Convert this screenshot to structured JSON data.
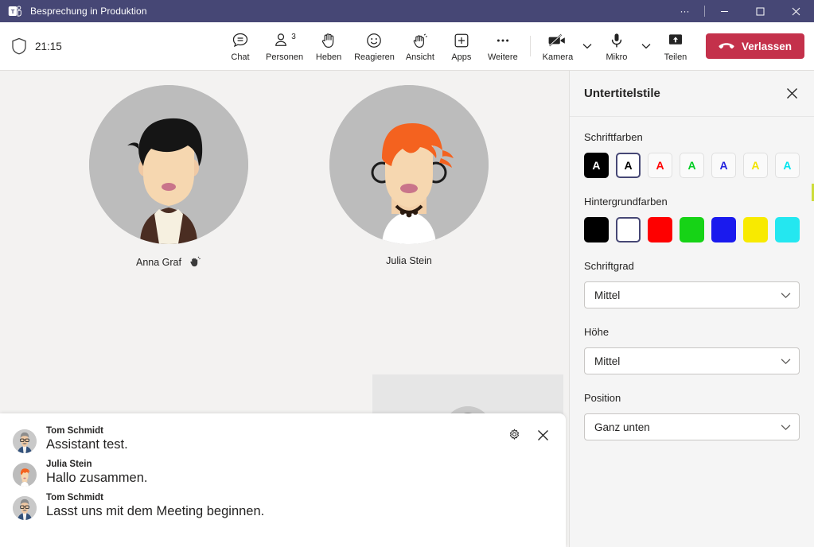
{
  "titlebar": {
    "app_icon": "teams-logo-icon",
    "title": "Besprechung in Produktion",
    "more_label": "···",
    "minimize_label": "—",
    "maximize_label": "□",
    "close_label": "✕"
  },
  "toolbar": {
    "shield_icon": "shield-icon",
    "timer": "21:15",
    "buttons": [
      {
        "icon": "chat-icon",
        "label": "Chat"
      },
      {
        "icon": "people-icon",
        "label": "Personen",
        "count": "3"
      },
      {
        "icon": "raise-hand-icon",
        "label": "Heben"
      },
      {
        "icon": "react-smiley-icon",
        "label": "Reagieren"
      },
      {
        "icon": "view-hand-icon",
        "label": "Ansicht"
      },
      {
        "icon": "apps-plus-icon",
        "label": "Apps"
      },
      {
        "icon": "more-dots-icon",
        "label": "Weitere"
      }
    ],
    "camera": {
      "icon": "camera-off-icon",
      "label": "Kamera",
      "chevron": "chevron-down-icon"
    },
    "mic": {
      "icon": "microphone-icon",
      "label": "Mikro",
      "chevron": "chevron-down-icon"
    },
    "share": {
      "icon": "share-screen-icon",
      "label": "Teilen"
    },
    "leave": {
      "icon": "hangup-phone-icon",
      "label": "Verlassen",
      "color": "#c4314b"
    }
  },
  "stage": {
    "participants": [
      {
        "name": "Anna Graf",
        "hand_raised": true,
        "hand_icon": "raised-hand-icon"
      },
      {
        "name": "Julia Stein",
        "hand_raised": false
      }
    ],
    "screen_share_tile": {
      "avatar": "tom-schmidt-avatar"
    }
  },
  "captions": {
    "settings_icon": "gear-icon",
    "close_icon": "close-icon",
    "entries": [
      {
        "speaker": "Tom Schmidt",
        "text": "Assistant test.",
        "avatar": "tom-schmidt-avatar"
      },
      {
        "speaker": "Julia Stein",
        "text": "Hallo zusammen.",
        "avatar": "julia-stein-avatar"
      },
      {
        "speaker": "Tom Schmidt",
        "text": "Lasst uns mit dem Meeting beginnen.",
        "avatar": "tom-schmidt-avatar"
      }
    ]
  },
  "panel": {
    "title": "Untertitelstile",
    "close_icon": "close-icon",
    "font_colors": {
      "label": "Schriftfarben",
      "swatches": [
        {
          "name": "black",
          "bg": "#000000",
          "letter": "A",
          "letter_color": "#ffffff",
          "selected": false,
          "filled": true
        },
        {
          "name": "white",
          "bg": "#ffffff",
          "letter": "A",
          "letter_color": "#000000",
          "selected": true,
          "filled": false
        },
        {
          "name": "red",
          "bg": "#fafafa",
          "letter": "A",
          "letter_color": "#ff0000",
          "selected": false,
          "filled": false
        },
        {
          "name": "green",
          "bg": "#fafafa",
          "letter": "A",
          "letter_color": "#00cc22",
          "selected": false,
          "filled": false
        },
        {
          "name": "blue",
          "bg": "#fafafa",
          "letter": "A",
          "letter_color": "#2222dd",
          "selected": false,
          "filled": false
        },
        {
          "name": "yellow",
          "bg": "#fafafa",
          "letter": "A",
          "letter_color": "#f2e300",
          "selected": false,
          "filled": false
        },
        {
          "name": "cyan",
          "bg": "#fafafa",
          "letter": "A",
          "letter_color": "#00e5ee",
          "selected": false,
          "filled": false
        }
      ]
    },
    "background_colors": {
      "label": "Hintergrundfarben",
      "swatches": [
        {
          "name": "black",
          "bg": "#000000",
          "selected": false
        },
        {
          "name": "white",
          "bg": "#ffffff",
          "selected": true
        },
        {
          "name": "red",
          "bg": "#fe0000",
          "selected": false
        },
        {
          "name": "green",
          "bg": "#16d316",
          "selected": false
        },
        {
          "name": "blue",
          "bg": "#1a1aee",
          "selected": false
        },
        {
          "name": "yellow",
          "bg": "#f8ea00",
          "selected": false
        },
        {
          "name": "cyan",
          "bg": "#24e7f0",
          "selected": false
        }
      ]
    },
    "font_size": {
      "label": "Schriftgrad",
      "value": "Mittel",
      "chevron": "chevron-down-icon"
    },
    "height": {
      "label": "Höhe",
      "value": "Mittel",
      "chevron": "chevron-down-icon"
    },
    "position": {
      "label": "Position",
      "value": "Ganz unten",
      "chevron": "chevron-down-icon"
    }
  }
}
